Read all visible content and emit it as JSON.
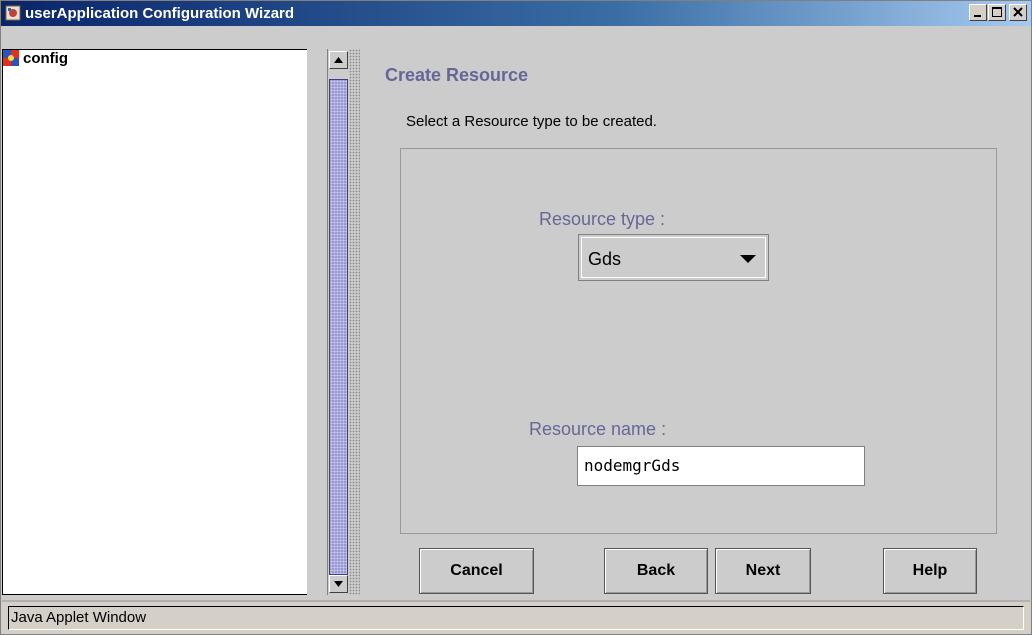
{
  "window": {
    "title": "userApplication Configuration Wizard"
  },
  "tree": {
    "root_label": "config"
  },
  "content": {
    "title": "Create Resource",
    "instructions": "Select a Resource type to be created.",
    "resource_type_label": "Resource type  :",
    "resource_type_value": "Gds",
    "resource_name_label": "Resource name  :",
    "resource_name_value": "nodemgrGds"
  },
  "buttons": {
    "cancel": "Cancel",
    "back": "Back",
    "next": "Next",
    "help": "Help"
  },
  "status": {
    "text": "Java Applet Window"
  },
  "colors": {
    "accent_text": "#666699",
    "scroll_thumb": "#9999cc",
    "titlebar": "#0a246a"
  }
}
